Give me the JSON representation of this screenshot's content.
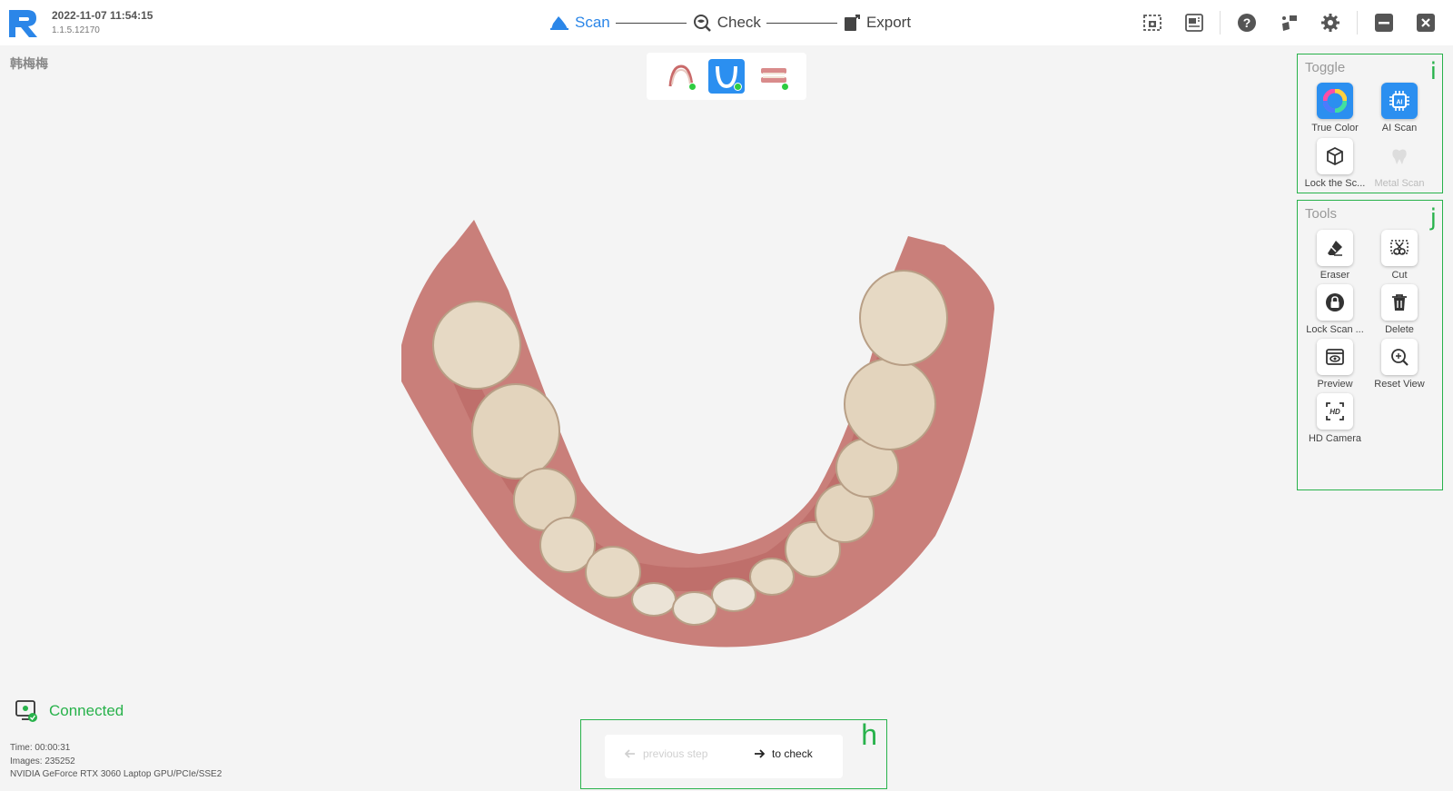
{
  "header": {
    "datetime": "2022-11-07 11:54:15",
    "version": "1.1.5.12170"
  },
  "steps": [
    {
      "label": "Scan",
      "active": true
    },
    {
      "label": "Check",
      "active": false
    },
    {
      "label": "Export",
      "active": false
    }
  ],
  "top_icons": [
    "screenshot-icon",
    "gallery-icon",
    "help-icon",
    "device-icon",
    "settings-icon",
    "minimize-icon",
    "close-icon"
  ],
  "patient_name": "韩梅梅",
  "jaw_selector": {
    "items": [
      {
        "name": "upper-jaw",
        "active": false,
        "complete": true
      },
      {
        "name": "lower-jaw",
        "active": true,
        "complete": true
      },
      {
        "name": "bite",
        "active": false,
        "complete": true
      }
    ]
  },
  "toggle_panel": {
    "title": "Toggle",
    "mark": "i",
    "items": [
      {
        "label": "True Color",
        "icon": "color-wheel-icon",
        "active": true
      },
      {
        "label": "AI Scan",
        "icon": "ai-chip-icon",
        "active": true
      },
      {
        "label": "Lock the Sc...",
        "icon": "cube-icon",
        "active": false
      },
      {
        "label": "Metal Scan",
        "icon": "tooth-icon",
        "disabled": true
      }
    ]
  },
  "tools_panel": {
    "title": "Tools",
    "mark": "j",
    "items": [
      {
        "label": "Eraser",
        "icon": "eraser-icon"
      },
      {
        "label": "Cut",
        "icon": "cut-icon"
      },
      {
        "label": "Lock Scan ...",
        "icon": "lock-icon"
      },
      {
        "label": "Delete",
        "icon": "trash-icon"
      },
      {
        "label": "Preview",
        "icon": "preview-icon"
      },
      {
        "label": "Reset View",
        "icon": "reset-view-icon"
      },
      {
        "label": "HD Camera",
        "icon": "hd-camera-icon"
      }
    ]
  },
  "status": {
    "connection": "Connected",
    "time": "Time: 00:00:31",
    "images": "Images: 235252",
    "gpu": "NVIDIA GeForce RTX 3060 Laptop GPU/PCIe/SSE2"
  },
  "navigation": {
    "previous": "previous step",
    "next": "to check",
    "mark": "h"
  },
  "colors": {
    "accent": "#2b8ff0",
    "success": "#28b24b"
  }
}
